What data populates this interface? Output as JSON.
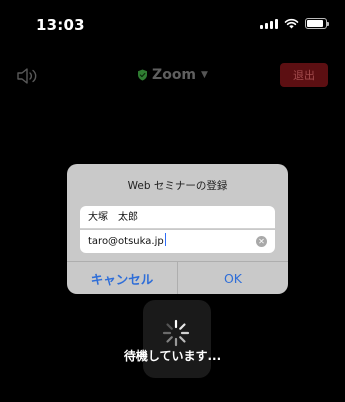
{
  "status_bar": {
    "time": "13:03"
  },
  "meeting_bar": {
    "title": "Zoom",
    "leave_label": "退出"
  },
  "dialog": {
    "title": "Web セミナーの登録",
    "name_value": "大塚　太郎",
    "email_value": "taro@otsuka.jp",
    "cancel_label": "キャンセル",
    "ok_label": "OK"
  },
  "waiting": {
    "text": "待機しています..."
  },
  "colors": {
    "background": "#000000",
    "dialog_bg": "#c9c9c9",
    "accent_blue": "#2f6ed8",
    "leave_red": "#5c0f12",
    "shield_green": "#2f7d32"
  },
  "icons": {
    "signal": "cellular-signal-icon",
    "wifi": "wifi-icon",
    "battery": "battery-icon",
    "speaker": "speaker-icon",
    "shield": "shield-check-icon",
    "chevron": "chevron-down-icon",
    "clear": "clear-text-icon",
    "spinner": "loading-spinner-icon"
  }
}
